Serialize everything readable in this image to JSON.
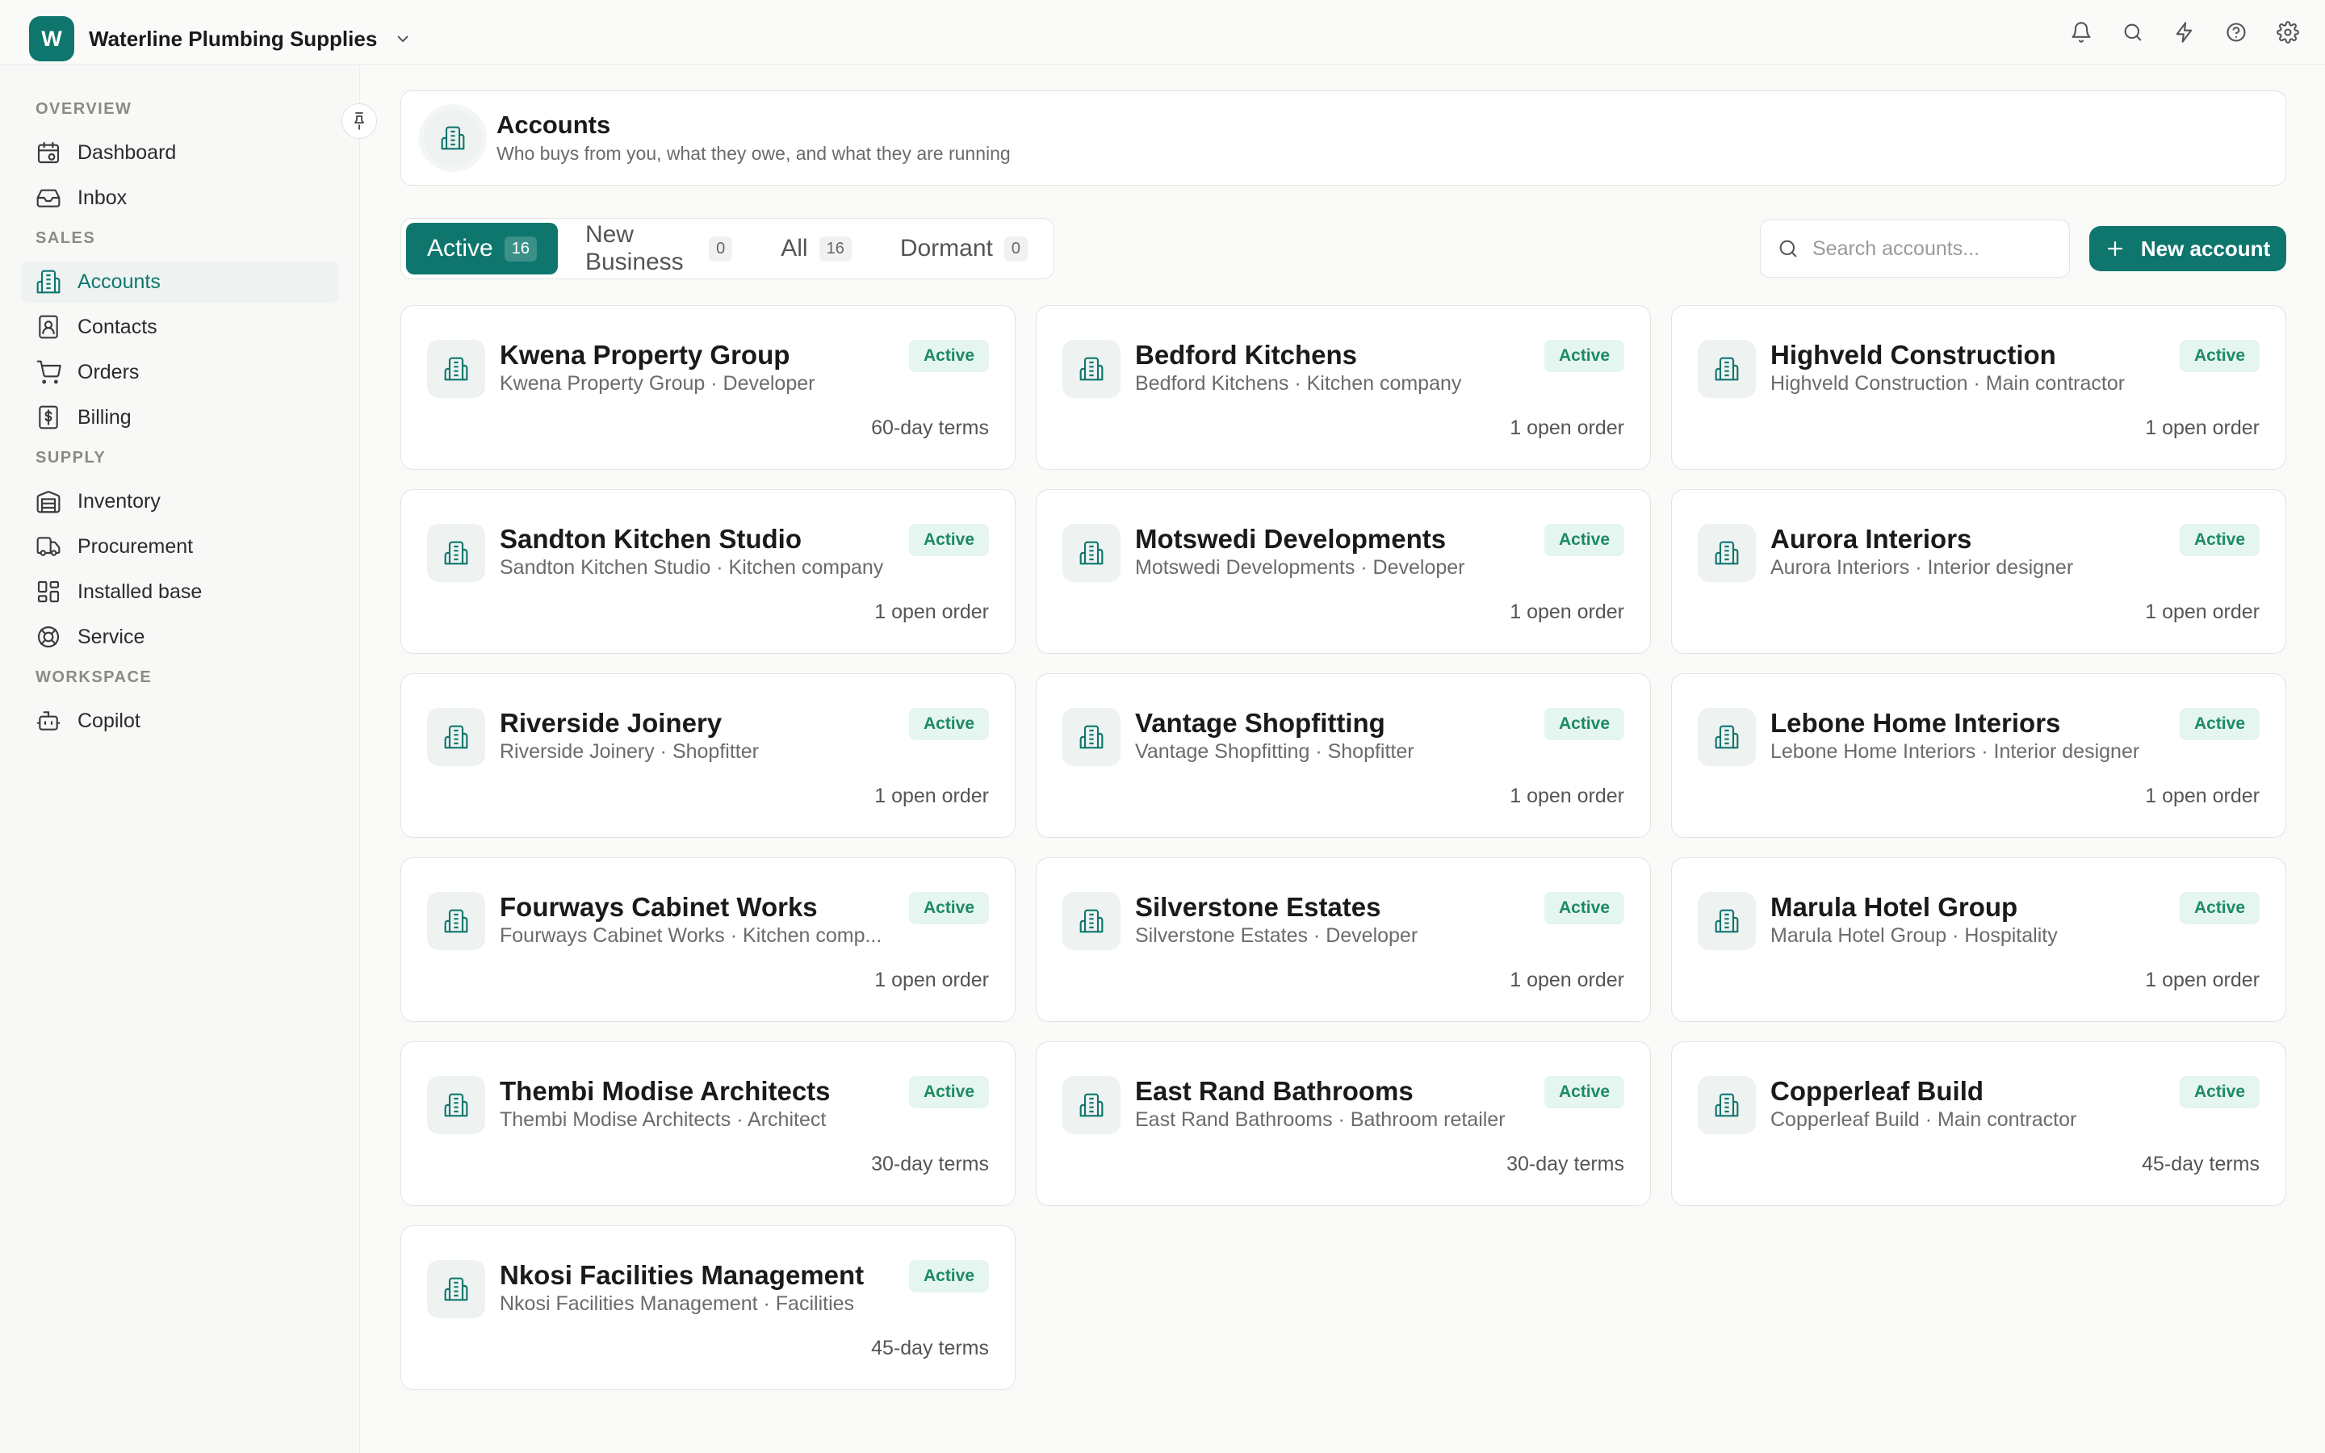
{
  "org": {
    "initial": "W",
    "name": "Waterline Plumbing Supplies"
  },
  "top_icons": [
    "bell-icon",
    "search-icon",
    "bolt-icon",
    "help-icon",
    "gear-icon"
  ],
  "sidebar": {
    "sections": [
      {
        "label": "OVERVIEW",
        "items": [
          {
            "label": "Dashboard",
            "icon": "calendar-icon",
            "active": false
          },
          {
            "label": "Inbox",
            "icon": "inbox-icon",
            "active": false
          }
        ]
      },
      {
        "label": "SALES",
        "items": [
          {
            "label": "Accounts",
            "icon": "building-icon",
            "active": true
          },
          {
            "label": "Contacts",
            "icon": "contact-icon",
            "active": false
          },
          {
            "label": "Orders",
            "icon": "cart-icon",
            "active": false
          },
          {
            "label": "Billing",
            "icon": "dollar-icon",
            "active": false
          }
        ]
      },
      {
        "label": "SUPPLY",
        "items": [
          {
            "label": "Inventory",
            "icon": "warehouse-icon",
            "active": false
          },
          {
            "label": "Procurement",
            "icon": "truck-icon",
            "active": false
          },
          {
            "label": "Installed base",
            "icon": "grid-icon",
            "active": false
          },
          {
            "label": "Service",
            "icon": "lifebuoy-icon",
            "active": false
          }
        ]
      },
      {
        "label": "WORKSPACE",
        "items": [
          {
            "label": "Copilot",
            "icon": "bot-icon",
            "active": false
          }
        ]
      }
    ]
  },
  "header": {
    "title": "Accounts",
    "subtitle": "Who buys from you, what they owe, and what they are running"
  },
  "tabs": [
    {
      "label": "Active",
      "count": "16",
      "active": true
    },
    {
      "label": "New Business",
      "count": "0",
      "active": false
    },
    {
      "label": "All",
      "count": "16",
      "active": false
    },
    {
      "label": "Dormant",
      "count": "0",
      "active": false
    }
  ],
  "search": {
    "placeholder": "Search accounts...",
    "value": ""
  },
  "new_button_label": "New account",
  "accounts": [
    {
      "name": "Kwena Property Group",
      "sub": "Kwena Property Group · Developer",
      "status": "Active",
      "meta": "60-day terms"
    },
    {
      "name": "Bedford Kitchens",
      "sub": "Bedford Kitchens · Kitchen company",
      "status": "Active",
      "meta": "1 open order"
    },
    {
      "name": "Highveld Construction",
      "sub": "Highveld Construction · Main contractor",
      "status": "Active",
      "meta": "1 open order"
    },
    {
      "name": "Sandton Kitchen Studio",
      "sub": "Sandton Kitchen Studio · Kitchen company",
      "status": "Active",
      "meta": "1 open order"
    },
    {
      "name": "Motswedi Developments",
      "sub": "Motswedi Developments · Developer",
      "status": "Active",
      "meta": "1 open order"
    },
    {
      "name": "Aurora Interiors",
      "sub": "Aurora Interiors · Interior designer",
      "status": "Active",
      "meta": "1 open order"
    },
    {
      "name": "Riverside Joinery",
      "sub": "Riverside Joinery · Shopfitter",
      "status": "Active",
      "meta": "1 open order"
    },
    {
      "name": "Vantage Shopfitting",
      "sub": "Vantage Shopfitting · Shopfitter",
      "status": "Active",
      "meta": "1 open order"
    },
    {
      "name": "Lebone Home Interiors",
      "sub": "Lebone Home Interiors · Interior designer",
      "status": "Active",
      "meta": "1 open order"
    },
    {
      "name": "Fourways Cabinet Works",
      "sub": "Fourways Cabinet Works · Kitchen comp...",
      "status": "Active",
      "meta": "1 open order"
    },
    {
      "name": "Silverstone Estates",
      "sub": "Silverstone Estates · Developer",
      "status": "Active",
      "meta": "1 open order"
    },
    {
      "name": "Marula Hotel Group",
      "sub": "Marula Hotel Group · Hospitality",
      "status": "Active",
      "meta": "1 open order"
    },
    {
      "name": "Thembi Modise Architects",
      "sub": "Thembi Modise Architects · Architect",
      "status": "Active",
      "meta": "30-day terms"
    },
    {
      "name": "East Rand Bathrooms",
      "sub": "East Rand Bathrooms · Bathroom retailer",
      "status": "Active",
      "meta": "30-day terms"
    },
    {
      "name": "Copperleaf Build",
      "sub": "Copperleaf Build · Main contractor",
      "status": "Active",
      "meta": "45-day terms"
    },
    {
      "name": "Nkosi Facilities Management",
      "sub": "Nkosi Facilities Management · Facilities",
      "status": "Active",
      "meta": "45-day terms"
    }
  ],
  "colors": {
    "accent": "#0f766e",
    "badge_bg": "#e5f5ef",
    "badge_text": "#1d8a62"
  }
}
